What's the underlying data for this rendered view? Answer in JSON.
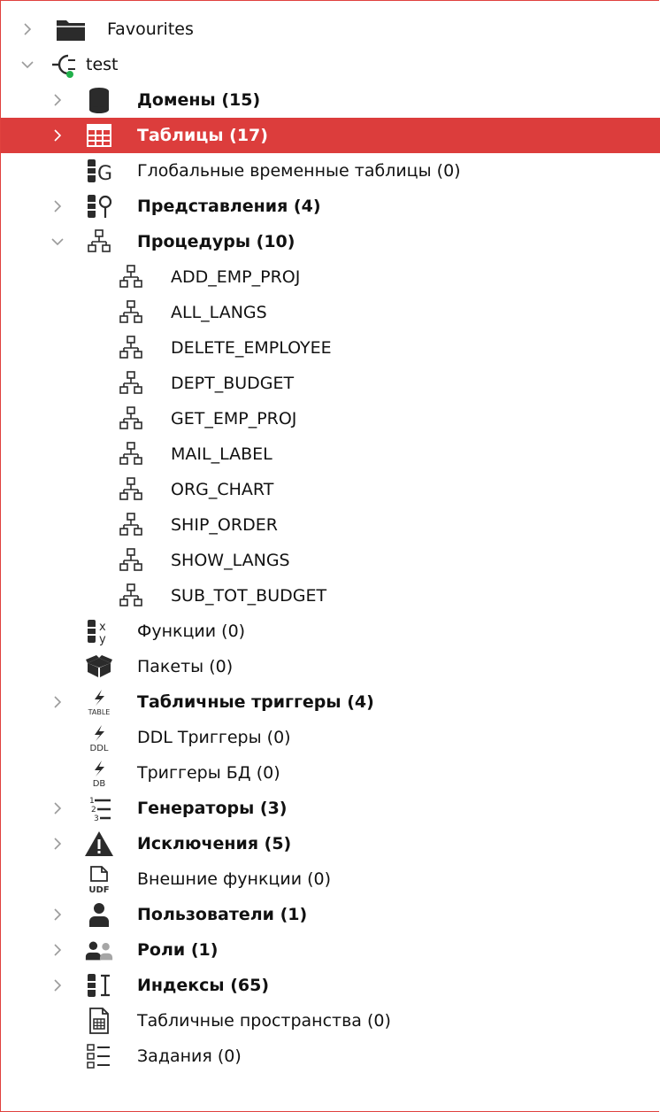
{
  "colors": {
    "selection_bg": "#dc3d3c",
    "frame_border": "#e0413e",
    "icon_dark": "#2b2b2b",
    "chevron": "#9b9b9b",
    "connection_dot": "#21b04b"
  },
  "tree": {
    "favourites": {
      "label": "Favourites",
      "icon": "folder-icon"
    },
    "connection": {
      "label": "test",
      "icon": "plug-connected-icon"
    },
    "domains": {
      "label": "Домены (15)",
      "icon": "cylinder-icon"
    },
    "tables": {
      "label": "Таблицы (17)",
      "icon": "table-icon"
    },
    "global_temp_tables": {
      "label": "Глобальные временные таблицы (0)",
      "icon": "global-temp-table-icon"
    },
    "views": {
      "label": "Представления (4)",
      "icon": "view-icon"
    },
    "procedures": {
      "label": "Процедуры (10)",
      "icon": "procedure-icon",
      "items": [
        "ADD_EMP_PROJ",
        "ALL_LANGS",
        "DELETE_EMPLOYEE",
        "DEPT_BUDGET",
        "GET_EMP_PROJ",
        "MAIL_LABEL",
        "ORG_CHART",
        "SHIP_ORDER",
        "SHOW_LANGS",
        "SUB_TOT_BUDGET"
      ]
    },
    "functions": {
      "label": "Функции (0)",
      "icon": "function-icon",
      "icon_text": "x y"
    },
    "packages": {
      "label": "Пакеты (0)",
      "icon": "package-icon"
    },
    "table_triggers": {
      "label": "Табличные триггеры (4)",
      "icon": "table-trigger-icon",
      "icon_text": "TABLE"
    },
    "ddl_triggers": {
      "label": "DDL Триггеры (0)",
      "icon": "ddl-trigger-icon",
      "icon_text": "DDL"
    },
    "db_triggers": {
      "label": "Триггеры БД (0)",
      "icon": "db-trigger-icon",
      "icon_text": "DB"
    },
    "generators": {
      "label": "Генераторы (3)",
      "icon": "generator-icon",
      "icon_text": "1 2 3"
    },
    "exceptions": {
      "label": "Исключения (5)",
      "icon": "warning-icon"
    },
    "udf": {
      "label": "Внешние функции (0)",
      "icon": "udf-icon",
      "icon_text": "UDF"
    },
    "users": {
      "label": "Пользователи (1)",
      "icon": "user-icon"
    },
    "roles": {
      "label": "Роли (1)",
      "icon": "roles-icon"
    },
    "indices": {
      "label": "Индексы (65)",
      "icon": "index-icon"
    },
    "tablespaces": {
      "label": "Табличные пространства (0)",
      "icon": "tablespace-icon"
    },
    "jobs": {
      "label": "Задания (0)",
      "icon": "jobs-icon"
    }
  }
}
